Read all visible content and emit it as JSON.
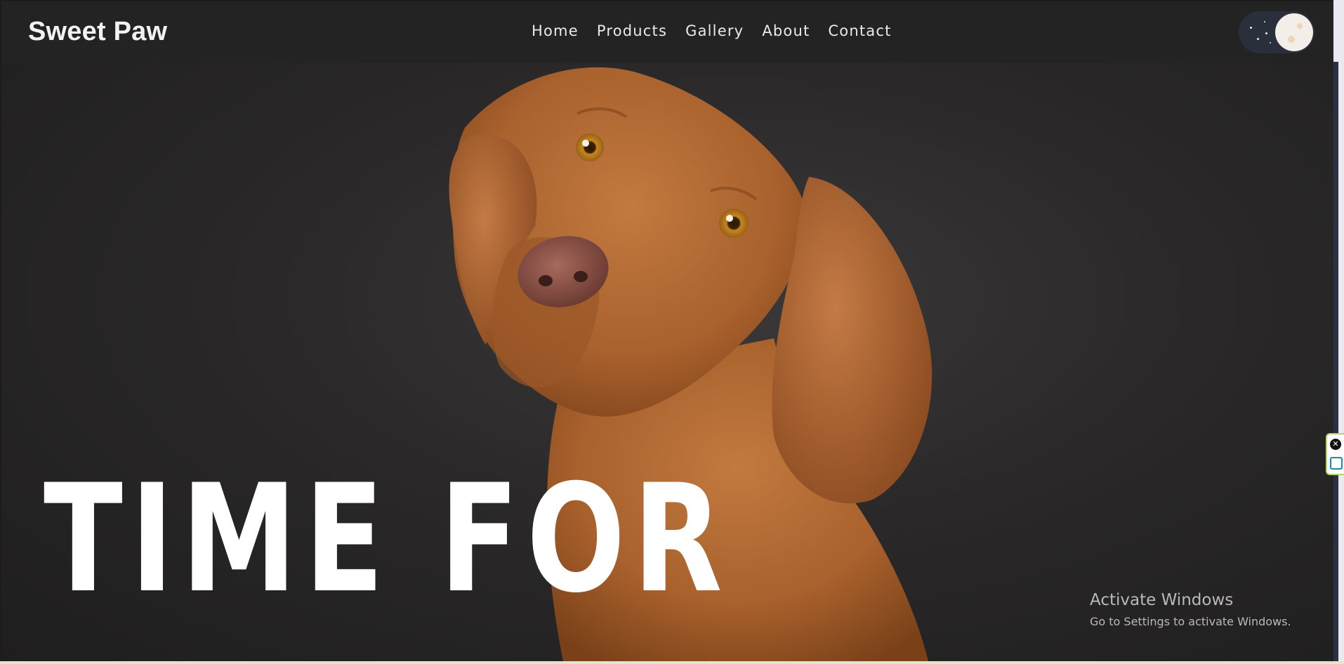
{
  "brand": {
    "name": "Sweet Paw"
  },
  "nav": {
    "items": [
      {
        "label": "Home"
      },
      {
        "label": "Products"
      },
      {
        "label": "Gallery"
      },
      {
        "label": "About"
      },
      {
        "label": "Contact"
      }
    ]
  },
  "theme_toggle": {
    "mode": "dark",
    "icon": "moon-toggle-icon"
  },
  "hero": {
    "headline": "TIME FOR",
    "image": "dog-photo"
  },
  "system_overlay": {
    "title": "Activate Windows",
    "subtitle": "Go to Settings to activate Windows."
  },
  "colors": {
    "background": "#2a2828",
    "navbar": "#232323",
    "text": "#ffffff",
    "dog_fur": "#b06a35"
  }
}
